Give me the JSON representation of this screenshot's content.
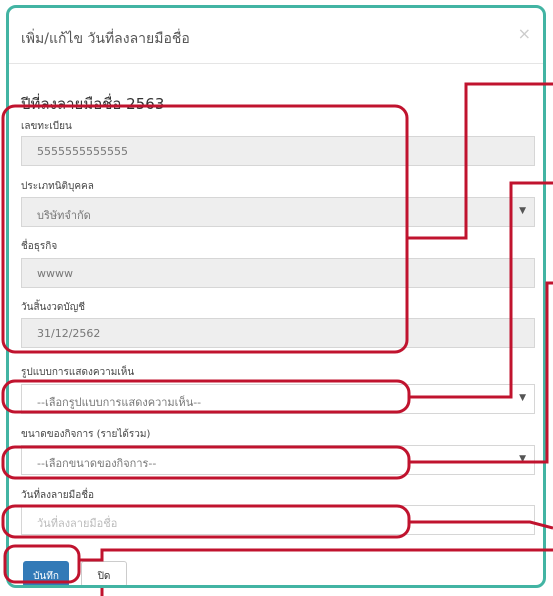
{
  "modal": {
    "title": "เพิ่ม/แก้ไข วันที่ลงลายมือชื่อ",
    "close_symbol": "×",
    "year_heading": "ปีที่ลงลายมือชื่อ 2563"
  },
  "fields": {
    "tax_id": {
      "label": "เลขทะเบียน",
      "value": "5555555555555"
    },
    "entity_type": {
      "label": "ประเภทนิติบุคคล",
      "value": "บริษัทจำกัด"
    },
    "business_name": {
      "label": "ชื่อธุรกิจ",
      "value": "wwww"
    },
    "fiscal_end": {
      "label": "วันสิ้นงวดบัญชี",
      "value": "31/12/2562"
    },
    "opinion_type": {
      "label": "รูปแบบการแสดงความเห็น",
      "value": "--เลือกรูปแบบการแสดงความเห็น--"
    },
    "business_size": {
      "label": "ขนาดของกิจการ (รายได้รวม)",
      "value": "--เลือกขนาดของกิจการ--"
    },
    "sign_date": {
      "label": "วันที่ลงลายมือชื่อ",
      "placeholder": "วันที่ลงลายมือชื่อ"
    }
  },
  "buttons": {
    "save": "บันทึก",
    "close": "ปิด"
  },
  "colors": {
    "frame": "#42b4a3",
    "annotation": "#c0132e",
    "primary": "#337ab7"
  }
}
